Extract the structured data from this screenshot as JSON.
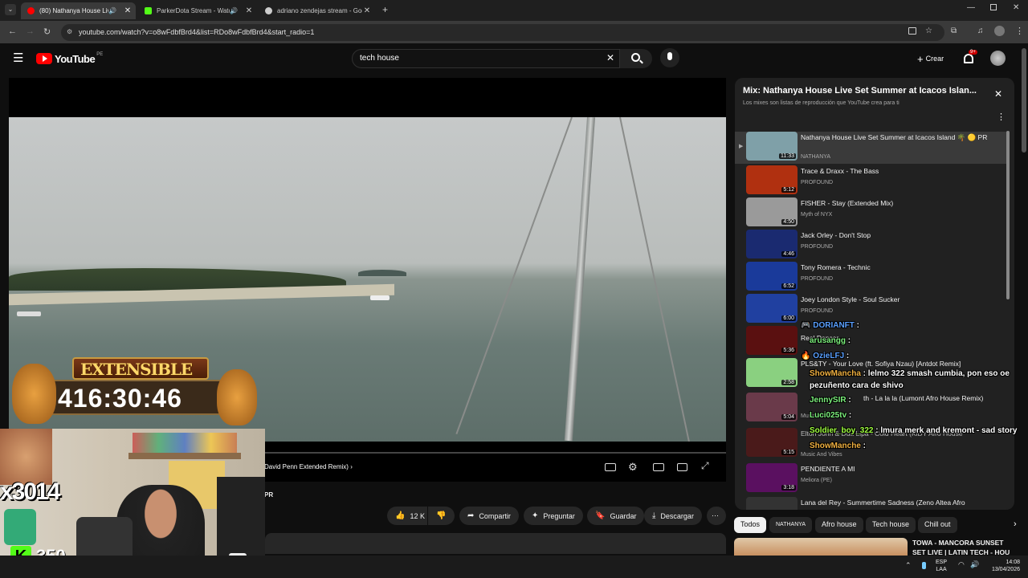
{
  "browser": {
    "tabs": [
      {
        "title": "(80) Nathanya House Live S",
        "active": true,
        "favicon_color": "#ff0000"
      },
      {
        "title": "ParkerDota Stream - Watch",
        "active": false,
        "favicon_color": "#53fc18"
      },
      {
        "title": "adriano zendejas stream - Goo",
        "active": false,
        "favicon_color": "#cccccc"
      }
    ],
    "new_tab": "+",
    "url": "youtube.com/watch?v=o8wFdbfBrd4&list=RDo8wFdbfBrd4&start_radio=1"
  },
  "youtube": {
    "logo_text": "YouTube",
    "logo_region": "PE",
    "search_value": "tech house",
    "create_label": "Crear",
    "notif_badge": "9+"
  },
  "player": {
    "song_label": "David Penn Extended Remix)",
    "channel_frag": "PR"
  },
  "actions": {
    "likes": "12 K",
    "share": "Compartir",
    "ask": "Preguntar",
    "save": "Guardar",
    "download": "Descargar"
  },
  "playlist": {
    "title": "Mix: Nathanya House Live Set Summer at Icacos Islan...",
    "subtitle": "Los mixes son listas de reproducción que YouTube crea para ti",
    "items": [
      {
        "title": "Nathanya House Live Set Summer at Icacos Island 🌴 🟡 PR",
        "channel": "NATHANYA",
        "duration": "11:33",
        "thumb_color": "#7fa0a8"
      },
      {
        "title": "Trace & Draxx - The Bass",
        "channel": "PROFOUND",
        "duration": "5:12",
        "thumb_color": "#b03010"
      },
      {
        "title": "FISHER - Stay (Extended Mix)",
        "channel": "Myth of NYX",
        "duration": "4:50",
        "thumb_color": "#9a9a9a"
      },
      {
        "title": "Jack Orley - Don't Stop",
        "channel": "PROFOUND",
        "duration": "4:46",
        "thumb_color": "#1a2a70"
      },
      {
        "title": "Tony Romera - Technic",
        "channel": "PROFOUND",
        "duration": "6:52",
        "thumb_color": "#1a3a9a"
      },
      {
        "title": "Joey London Style - Soul Sucker",
        "channel": "PROFOUND",
        "duration": "6:00",
        "thumb_color": "#2040a0"
      },
      {
        "title": "Real Dancer",
        "channel": "",
        "duration": "5:36",
        "thumb_color": "#5a1010"
      },
      {
        "title": "PLS&TY - Your Love (ft. Sofiya Nzau) [Antdot Remix]",
        "channel": "",
        "duration": "2:58",
        "thumb_color": "#8ad080"
      },
      {
        "title": "th - La la la (Lumont Afro House Remix)",
        "channel": "Music And Vibes",
        "duration": "5:04",
        "thumb_color": "#6a3a4a"
      },
      {
        "title": "Elton John & Dua Lipa - Cold Heart (KiDY Afro House",
        "channel": "Music And Vibes",
        "duration": "5:15",
        "thumb_color": "#4a1a1a"
      },
      {
        "title": "PENDIENTE A MI",
        "channel": "Meliora (PE)",
        "duration": "3:18",
        "thumb_color": "#5a1060"
      },
      {
        "title": "Lana del Rey - Summertime Sadness (Zeno Altea Afro",
        "channel": "",
        "duration": "",
        "thumb_color": "#333333"
      }
    ]
  },
  "chips": [
    "Todos",
    "NATHANYA",
    "Afro house",
    "Tech house",
    "Chill out"
  ],
  "recommendation": {
    "title_line1": "TOWA - MANCORA SUNSET",
    "title_line2": "SET LIVE | LATIN TECH - HOU"
  },
  "stream_overlay": {
    "timer_label": "EXTENSIBLE",
    "timer_value": "416:30:46",
    "side_text": "x3014",
    "kick_count": "350",
    "chat": [
      {
        "user": "DORIANFT",
        "msg": "",
        "color": "#5aa0ff"
      },
      {
        "user": "arusangg",
        "msg": "",
        "color": "#7cf07c"
      },
      {
        "user": "OzieLFJ",
        "msg": "",
        "color": "#5aa0ff"
      },
      {
        "user": "ShowMancha",
        "msg": "lelmo 322 smash cumbia, pon eso oe pezuñento cara de shivo",
        "color": "#f0b040"
      },
      {
        "user": "JennySIR",
        "msg": "",
        "color": "#7cf07c"
      },
      {
        "user": "Luci025tv",
        "msg": "",
        "color": "#7cf07c"
      },
      {
        "user": "Soldier_boy_322",
        "msg": "lmura merk and kremont - sad story",
        "color": "#a0ff40"
      },
      {
        "user": "ShowManche",
        "msg": "",
        "color": "#f0b040"
      }
    ]
  },
  "taskbar": {
    "lang1": "ESP",
    "lang2": "LAA",
    "time": "14:08",
    "date": "13/04/2026"
  },
  "colors": {
    "yt_red": "#ff0000",
    "kick_green": "#53fc18",
    "bg": "#0f0f0f",
    "panel": "#212121"
  }
}
